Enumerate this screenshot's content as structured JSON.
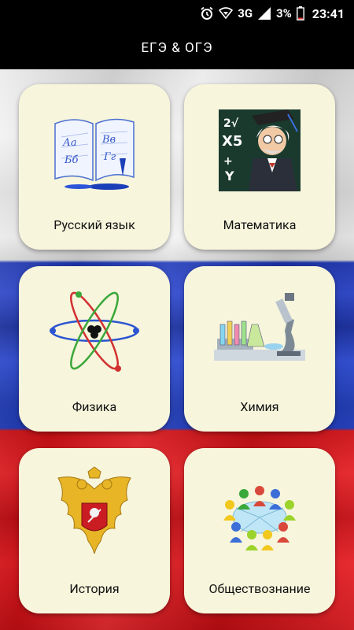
{
  "status_bar": {
    "network": "3G",
    "battery": "3%",
    "time": "23:41",
    "icons": [
      "alarm-icon",
      "signal-icon",
      "battery-icon"
    ]
  },
  "app_bar": {
    "title": "ЕГЭ & ОГЭ"
  },
  "subjects": [
    {
      "label": "Русский язык",
      "icon": "book-icon"
    },
    {
      "label": "Математика",
      "icon": "professor-icon"
    },
    {
      "label": "Физика",
      "icon": "atom-icon"
    },
    {
      "label": "Химия",
      "icon": "microscope-icon"
    },
    {
      "label": "История",
      "icon": "coat-of-arms-icon"
    },
    {
      "label": "Обществознание",
      "icon": "people-circle-icon"
    }
  ],
  "colors": {
    "card_bg": "#f7f5dc",
    "flag_white": "#eeeeee",
    "flag_blue": "#1f38b8",
    "flag_red": "#d20f14"
  }
}
